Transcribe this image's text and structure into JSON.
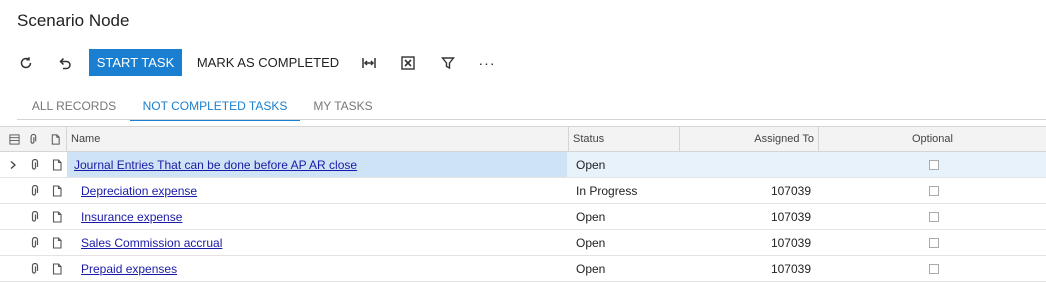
{
  "page": {
    "title": "Scenario Node"
  },
  "toolbar": {
    "refresh_icon": "refresh-icon",
    "undo_icon": "undo-icon",
    "start_task_label": "START TASK",
    "mark_completed_label": "MARK AS COMPLETED",
    "fit_icon": "fit-columns-icon",
    "excel_icon": "excel-export-icon",
    "filter_icon": "filter-icon",
    "more_label": "···"
  },
  "tabs": [
    {
      "label": "ALL RECORDS",
      "active": false
    },
    {
      "label": "NOT COMPLETED TASKS",
      "active": true
    },
    {
      "label": "MY TASKS",
      "active": false
    }
  ],
  "grid": {
    "columns": {
      "name": "Name",
      "status": "Status",
      "assigned_to": "Assigned To",
      "optional": "Optional"
    },
    "rows": [
      {
        "name": "Journal Entries That can be done before AP AR close",
        "status": "Open",
        "assigned_to": "",
        "optional": false,
        "selected": true,
        "indent": false
      },
      {
        "name": "Depreciation expense",
        "status": "In Progress",
        "assigned_to": "107039",
        "optional": false,
        "selected": false,
        "indent": true
      },
      {
        "name": "Insurance expense",
        "status": "Open",
        "assigned_to": "107039",
        "optional": false,
        "selected": false,
        "indent": true
      },
      {
        "name": "Sales Commission accrual",
        "status": "Open",
        "assigned_to": "107039",
        "optional": false,
        "selected": false,
        "indent": true
      },
      {
        "name": "Prepaid expenses",
        "status": "Open",
        "assigned_to": "107039",
        "optional": false,
        "selected": false,
        "indent": true
      }
    ]
  },
  "colors": {
    "accent": "#1a7fd0",
    "link": "#1a1aa8",
    "selected_row": "#cfe3f6"
  }
}
